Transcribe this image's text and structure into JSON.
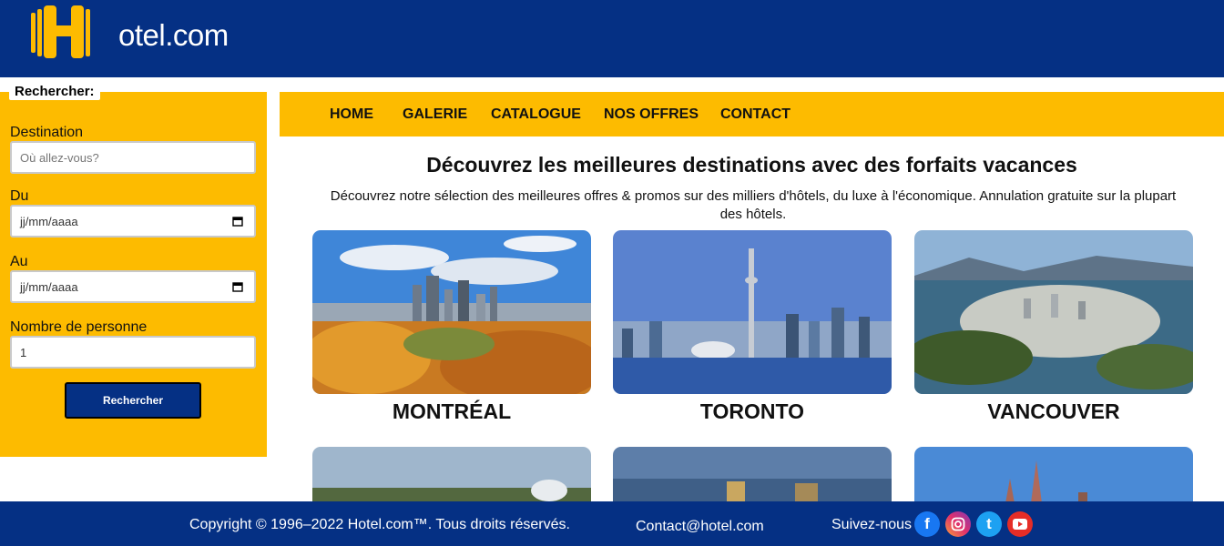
{
  "brand": {
    "name": "otel.com",
    "logo_letter": "H"
  },
  "search": {
    "legend": "Rechercher:",
    "destination_label": "Destination",
    "destination_placeholder": "Où allez-vous?",
    "from_label": "Du",
    "from_value": "jj/mm/aaaa",
    "to_label": "Au",
    "to_value": "jj/mm/aaaa",
    "people_label": "Nombre de personne",
    "people_value": "1",
    "button": "Rechercher"
  },
  "nav": {
    "items": [
      "HOME",
      "GALERIE",
      "CATALOGUE",
      "NOS OFFRES",
      "CONTACT"
    ]
  },
  "main": {
    "title": "Découvrez les meilleures destinations avec des forfaits vacances",
    "subtitle": "Découvrez notre sélection des meilleures offres & promos sur des milliers d'hôtels, du luxe à l'économique. Annulation gratuite sur la plupart des hôtels."
  },
  "destinations": [
    "MONTRÉAL",
    "TORONTO",
    "VANCOUVER"
  ],
  "footer": {
    "copyright": "Copyright © 1996–2022 Hotel.com™. Tous droits réservés.",
    "contact": "Contact@hotel.com",
    "follow": "Suivez-nous",
    "social_icons": [
      "facebook-icon",
      "instagram-icon",
      "twitter-icon",
      "youtube-icon"
    ]
  },
  "colors": {
    "navy": "#053084",
    "yellow": "#fdbb00"
  }
}
